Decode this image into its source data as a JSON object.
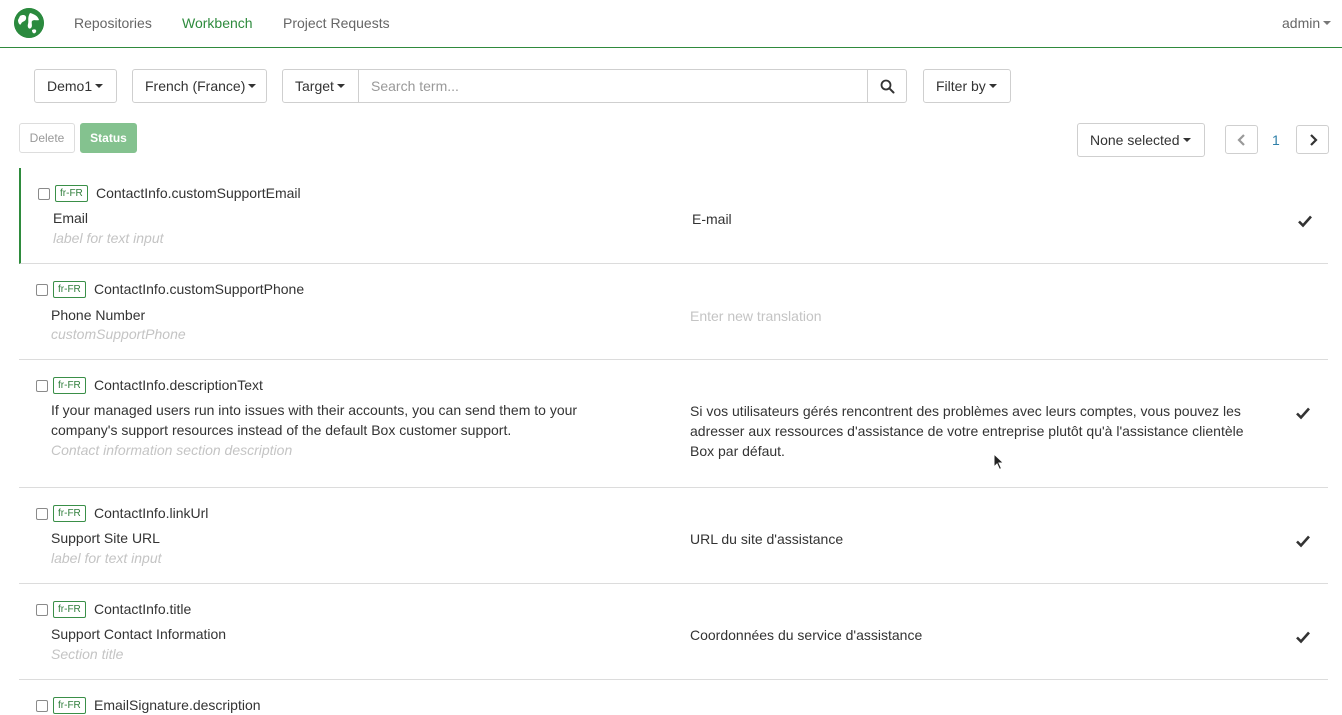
{
  "nav": {
    "links": [
      "Repositories",
      "Workbench",
      "Project Requests"
    ],
    "user": "admin"
  },
  "toolbar": {
    "repository": "Demo1",
    "locale": "French (France)",
    "search_type": "Target",
    "search_placeholder": "Search term...",
    "filter": "Filter by",
    "delete": "Delete",
    "status": "Status",
    "selection": "None selected",
    "page": "1"
  },
  "rows": [
    {
      "locale": "fr-FR",
      "key": "ContactInfo.customSupportEmail",
      "source": "Email",
      "comment": "label for text input",
      "target": "E-mail",
      "accepted": true
    },
    {
      "locale": "fr-FR",
      "key": "ContactInfo.customSupportPhone",
      "source": "Phone Number",
      "comment": "customSupportPhone",
      "target": "",
      "target_placeholder": "Enter new translation",
      "accepted": false
    },
    {
      "locale": "fr-FR",
      "key": "ContactInfo.descriptionText",
      "source": "If your managed users run into issues with their accounts, you can send them to your company's support resources instead of the default Box customer support.",
      "comment": "Contact information section description",
      "target": "Si vos utilisateurs gérés rencontrent des problèmes avec leurs comptes, vous pouvez les adresser aux ressources d'assistance de votre entreprise plutôt qu'à l'assistance clientèle Box par défaut.",
      "accepted": true
    },
    {
      "locale": "fr-FR",
      "key": "ContactInfo.linkUrl",
      "source": "Support Site URL",
      "comment": "label for text input",
      "target": "URL du site d'assistance",
      "accepted": true
    },
    {
      "locale": "fr-FR",
      "key": "ContactInfo.title",
      "source": "Support Contact Information",
      "comment": "Section title",
      "target": "Coordonnées du service d'assistance",
      "accepted": true
    },
    {
      "locale": "fr-FR",
      "key": "EmailSignature.description",
      "source": "",
      "comment": "",
      "target": "",
      "accepted": false
    }
  ],
  "colors": {
    "accent": "#2e8b3d",
    "status_button": "#84c28f",
    "locale_badge": "#3a8f48"
  },
  "icons": {
    "logo": "globe-icon",
    "search": "search-icon",
    "prev": "chevron-left-icon",
    "next": "chevron-right-icon",
    "accepted": "checkmark-icon"
  }
}
